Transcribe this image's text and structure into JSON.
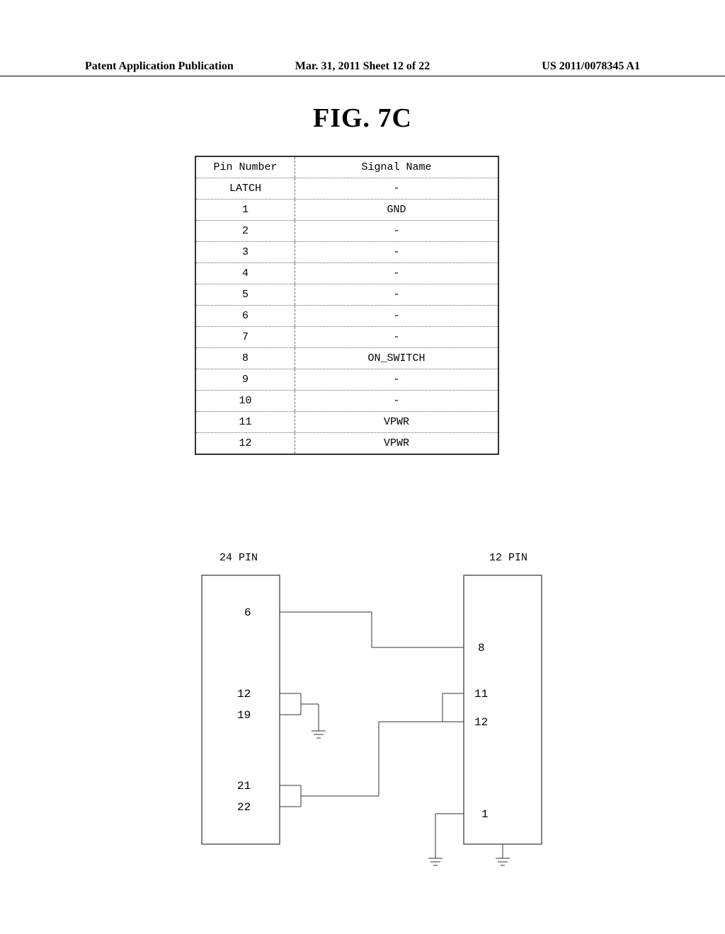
{
  "header": {
    "left": "Patent Application Publication",
    "mid": "Mar. 31, 2011  Sheet 12 of 22",
    "right": "US 2011/0078345 A1"
  },
  "figure_title": "FIG. 7C",
  "table": {
    "header": {
      "col1": "Pin Number",
      "col2": "Signal Name"
    },
    "rows": [
      {
        "col1": "LATCH",
        "col2": "-"
      },
      {
        "col1": "1",
        "col2": "GND"
      },
      {
        "col1": "2",
        "col2": "-"
      },
      {
        "col1": "3",
        "col2": "-"
      },
      {
        "col1": "4",
        "col2": "-"
      },
      {
        "col1": "5",
        "col2": "-"
      },
      {
        "col1": "6",
        "col2": "-"
      },
      {
        "col1": "7",
        "col2": "-"
      },
      {
        "col1": "8",
        "col2": "ON_SWITCH"
      },
      {
        "col1": "9",
        "col2": "-"
      },
      {
        "col1": "10",
        "col2": "-"
      },
      {
        "col1": "11",
        "col2": "VPWR"
      },
      {
        "col1": "12",
        "col2": "VPWR"
      }
    ]
  },
  "diagram": {
    "left_label": "24 PIN",
    "right_label": "12 PIN",
    "left_pins": {
      "p6": "6",
      "p12": "12",
      "p19": "19",
      "p21": "21",
      "p22": "22"
    },
    "right_pins": {
      "p8": "8",
      "p11": "11",
      "p12": "12",
      "p1": "1"
    }
  }
}
